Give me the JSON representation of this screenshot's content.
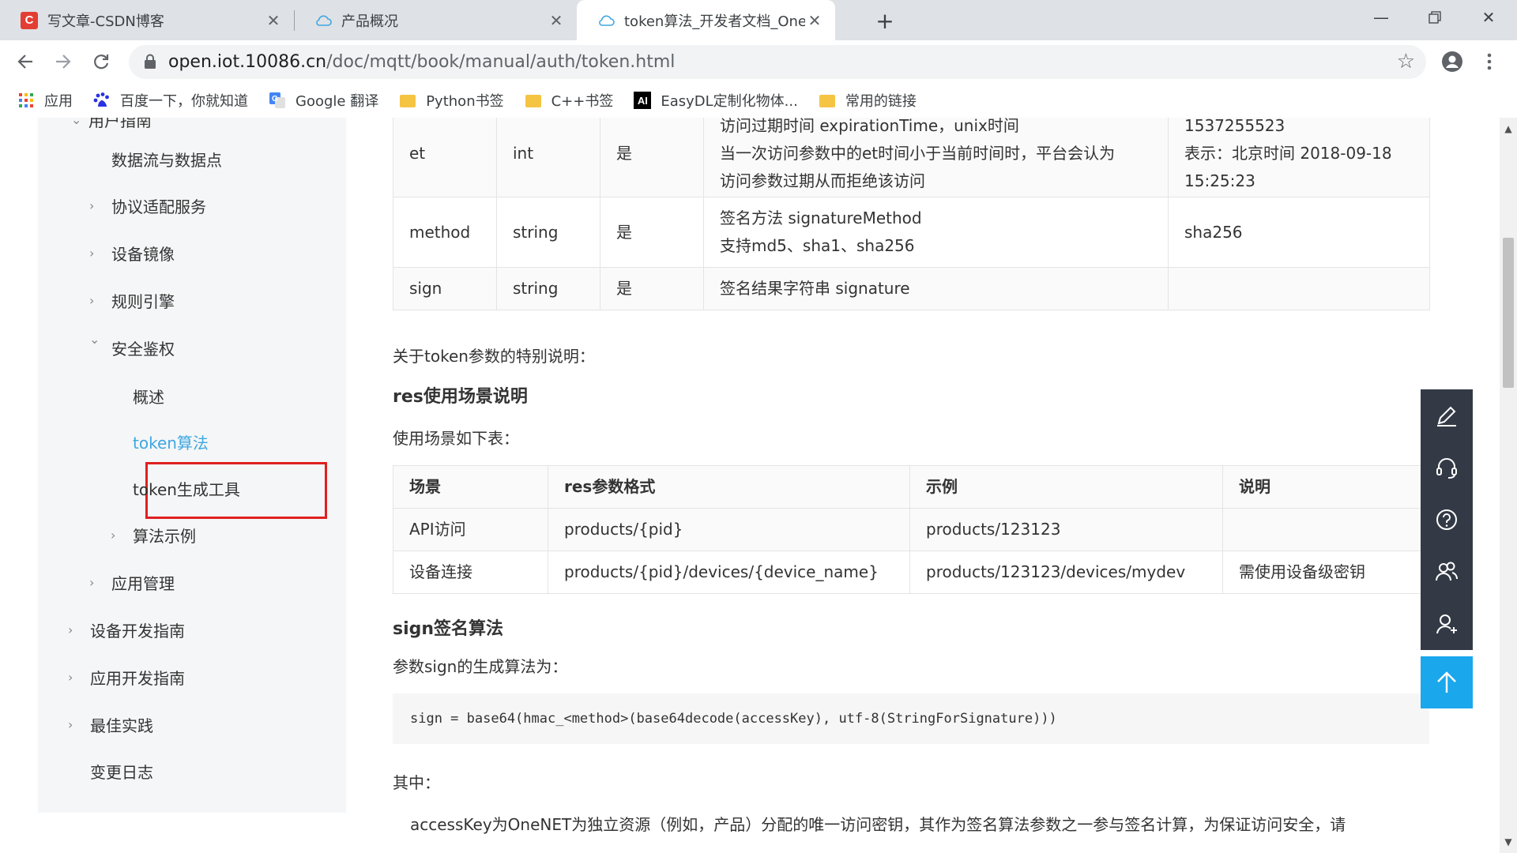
{
  "tabs": [
    {
      "title": "写文章-CSDN博客",
      "icon": "csdn-logo"
    },
    {
      "title": "产品概况",
      "icon": "cloud-icon"
    },
    {
      "title": "token算法_开发者文档_OneNET",
      "icon": "cloud-icon"
    }
  ],
  "address": {
    "host": "open.iot.10086.cn",
    "path": "/doc/mqtt/book/manual/auth/token.html"
  },
  "bookmarks": [
    {
      "label": "应用",
      "icon": "apps-grid-icon"
    },
    {
      "label": "百度一下，你就知道",
      "icon": "baidu-paw-icon"
    },
    {
      "label": "Google 翻译",
      "icon": "google-translate-icon"
    },
    {
      "label": "Python书签",
      "icon": "folder-icon"
    },
    {
      "label": "C++书签",
      "icon": "folder-icon"
    },
    {
      "label": "EasyDL定制化物体...",
      "icon": "ai-icon"
    },
    {
      "label": "常用的链接",
      "icon": "folder-icon"
    }
  ],
  "sidebar": {
    "partial_top": "用户指南",
    "items": [
      {
        "label": "数据流与数据点"
      },
      {
        "label": "协议适配服务"
      },
      {
        "label": "设备镜像"
      },
      {
        "label": "规则引擎"
      },
      {
        "label": "安全鉴权"
      },
      {
        "label": "概述"
      },
      {
        "label": "token算法"
      },
      {
        "label": "token生成工具"
      },
      {
        "label": "算法示例"
      },
      {
        "label": "应用管理"
      },
      {
        "label": "设备开发指南"
      },
      {
        "label": "应用开发指南"
      },
      {
        "label": "最佳实践"
      },
      {
        "label": "变更日志"
      }
    ]
  },
  "param_table": {
    "rows": [
      {
        "name": "et",
        "type": "int",
        "required": "是",
        "desc": [
          "访问过期时间 expirationTime，unix时间",
          "当一次访问参数中的et时间小于当前时间时，平台会认为",
          "访问参数过期从而拒绝该访问"
        ],
        "example": [
          "1537255523",
          "表示：北京时间 2018-09-18",
          "15:25:23"
        ]
      },
      {
        "name": "method",
        "type": "string",
        "required": "是",
        "desc": [
          "签名方法 signatureMethod",
          "支持md5、sha1、sha256"
        ],
        "example": [
          "sha256"
        ]
      },
      {
        "name": "sign",
        "type": "string",
        "required": "是",
        "desc": [
          "签名结果字符串 signature"
        ],
        "example": [
          ""
        ]
      }
    ]
  },
  "note_token": "关于token参数的特别说明：",
  "res_heading": "res使用场景说明",
  "res_intro": "使用场景如下表：",
  "res_table": {
    "headers": [
      "场景",
      "res参数格式",
      "示例",
      "说明"
    ],
    "rows": [
      [
        "API访问",
        "products/{pid}",
        "products/123123",
        ""
      ],
      [
        "设备连接",
        "products/{pid}/devices/{device_name}",
        "products/123123/devices/mydev",
        "需使用设备级密钥"
      ]
    ]
  },
  "sign_heading": "sign签名算法",
  "sign_intro": "参数sign的生成算法为：",
  "code": "sign = base64(hmac_<method>(base64decode(accessKey), utf-8(StringForSignature)))",
  "where_label": "其中：",
  "bullet": "accessKey为OneNET为独立资源（例如，产品）分配的唯一访问密钥，其作为签名算法参数之一参与签名计算，为保证访问安全，请"
}
